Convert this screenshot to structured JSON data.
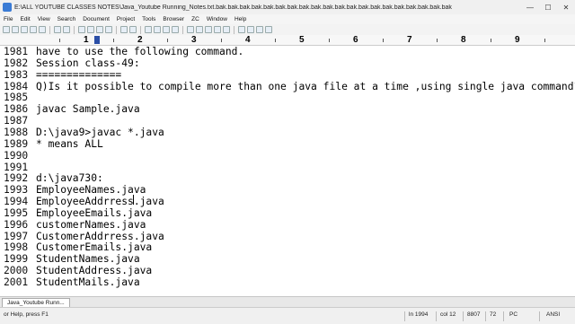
{
  "window": {
    "title": "E:\\ALL YOUTUBE CLASSES NOTES\\Java_Youtube Running_Notes.txt.bak.bak.bak.bak.bak.bak.bak.bak.bak.bak.bak.bak.bak.bak.bak.bak.bak.bak.bak.bak",
    "minimize": "—",
    "maximize": "☐",
    "close": "✕"
  },
  "menu": [
    "File",
    "Edit",
    "View",
    "Search",
    "Document",
    "Project",
    "Tools",
    "Browser",
    "ZC",
    "Window",
    "Help"
  ],
  "ruler": {
    "marks": [
      "1",
      "2",
      "3",
      "4",
      "5",
      "6",
      "7",
      "8",
      "9"
    ]
  },
  "editor": {
    "lines": [
      {
        "num": "1981",
        "text": "have to use the following command."
      },
      {
        "num": "1982",
        "text": "Session class-49:"
      },
      {
        "num": "1983",
        "text": "=============="
      },
      {
        "num": "1984",
        "text": "Q)Is it possible to compile more than one java file at a time ,using single java command?"
      },
      {
        "num": "1985",
        "text": ""
      },
      {
        "num": "1986",
        "text": "javac Sample.java"
      },
      {
        "num": "1987",
        "text": ""
      },
      {
        "num": "1988",
        "text": "D:\\java9>javac *.java"
      },
      {
        "num": "1989",
        "text": "* means ALL"
      },
      {
        "num": "1990",
        "text": ""
      },
      {
        "num": "1991",
        "text": ""
      },
      {
        "num": "1992",
        "text": "d:\\java730:"
      },
      {
        "num": "1993",
        "text": "EmployeeNames.java"
      },
      {
        "num": "1994",
        "text": "EmployeeAddrress.java"
      },
      {
        "num": "1995",
        "text": "EmployeeEmails.java"
      },
      {
        "num": "1996",
        "text": "customerNames.java"
      },
      {
        "num": "1997",
        "text": "CustomerAddrress.java"
      },
      {
        "num": "1998",
        "text": "CustomerEmails.java"
      },
      {
        "num": "1999",
        "text": "StudentNames.java"
      },
      {
        "num": "2000",
        "text": "StudentAddress.java"
      },
      {
        "num": "2001",
        "text": "StudentMails.java"
      }
    ]
  },
  "tabs": [
    {
      "label": "Java_Youtube Runn..."
    }
  ],
  "status": {
    "help": "or Help, press F1",
    "line": "ln 1994",
    "col": "col 12",
    "chars": "8807",
    "num": "72",
    "mode": "PC",
    "encoding": "ANSI"
  },
  "colors": {
    "accent": "#2a4ea6",
    "background": "#ffffff"
  }
}
